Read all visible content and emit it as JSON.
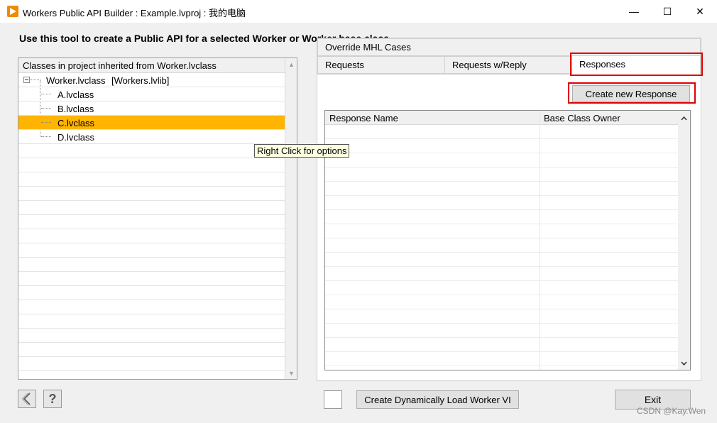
{
  "window": {
    "title": "Workers Public API Builder : Example.lvproj : 我的电脑",
    "minimize_glyph": "—",
    "maximize_glyph": "☐",
    "close_glyph": "✕"
  },
  "instruction": "Use this tool to create a Public API for a selected Worker or Worker base class",
  "classes_panel": {
    "header": "Classes in project inherited from Worker.lvclass",
    "root": {
      "label": "Worker.lvclass",
      "library": "[Workers.lvlib]"
    },
    "children": [
      "A.lvclass",
      "B.lvclass",
      "C.lvclass",
      "D.lvclass"
    ],
    "selected_index": 2
  },
  "tooltip": "Right Click for options",
  "tabs": {
    "override": "Override MHL Cases",
    "requests": "Requests",
    "requests_reply": "Requests w/Reply",
    "responses": "Responses"
  },
  "responses_tab": {
    "create_button": "Create new Response",
    "columns": [
      "Response Name",
      "Base Class Owner"
    ]
  },
  "footer": {
    "help_glyph": "?",
    "dynamic_load_button": "Create Dynamically Load Worker VI",
    "exit_button": "Exit"
  },
  "watermark": "CSDN @Kay.Wen",
  "colors": {
    "selection": "#ffb400",
    "highlight_border": "#e00000",
    "app_icon": "#f08a00"
  },
  "icons": {
    "app": "labview-play-icon",
    "back": "chevron-left-icon",
    "scroll_up": "triangle-up-icon",
    "scroll_down": "triangle-down-icon"
  }
}
